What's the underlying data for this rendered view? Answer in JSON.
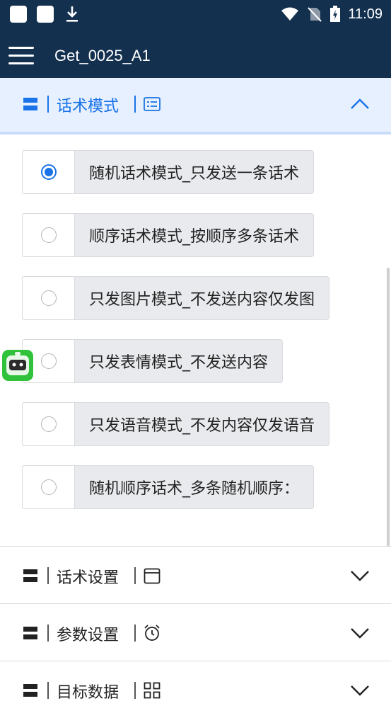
{
  "status_bar": {
    "time": "11:09"
  },
  "app_bar": {
    "title": "Get_0025_A1",
    "menu_icon": "hamburger-menu-icon"
  },
  "expanded_section": {
    "title": "话术模式",
    "icon": "list-card-icon",
    "chevron": "chevron-up-icon",
    "accent_color": "#1a73e8"
  },
  "options": [
    {
      "label": "随机话术模式_只发送一条话术",
      "selected": true
    },
    {
      "label": "顺序话术模式_按顺序多条话术",
      "selected": false
    },
    {
      "label": "只发图片模式_不发送内容仅发图",
      "selected": false
    },
    {
      "label": "只发表情模式_不发送内容",
      "selected": false
    },
    {
      "label": "只发语音模式_不发内容仅发语音",
      "selected": false
    },
    {
      "label": "随机顺序话术_多条随机顺序：",
      "selected": false
    }
  ],
  "collapsed_sections": [
    {
      "title": "话术设置",
      "icon": "calendar-icon",
      "chevron": "chevron-down-icon"
    },
    {
      "title": "参数设置",
      "icon": "alarm-clock-icon",
      "chevron": "chevron-down-icon"
    },
    {
      "title": "目标数据",
      "icon": "grid-icon",
      "chevron": "chevron-down-icon"
    }
  ],
  "colors": {
    "header_bg": "#13304f",
    "expanded_bg": "#e6f0ff",
    "option_bg": "#e8eaed"
  }
}
